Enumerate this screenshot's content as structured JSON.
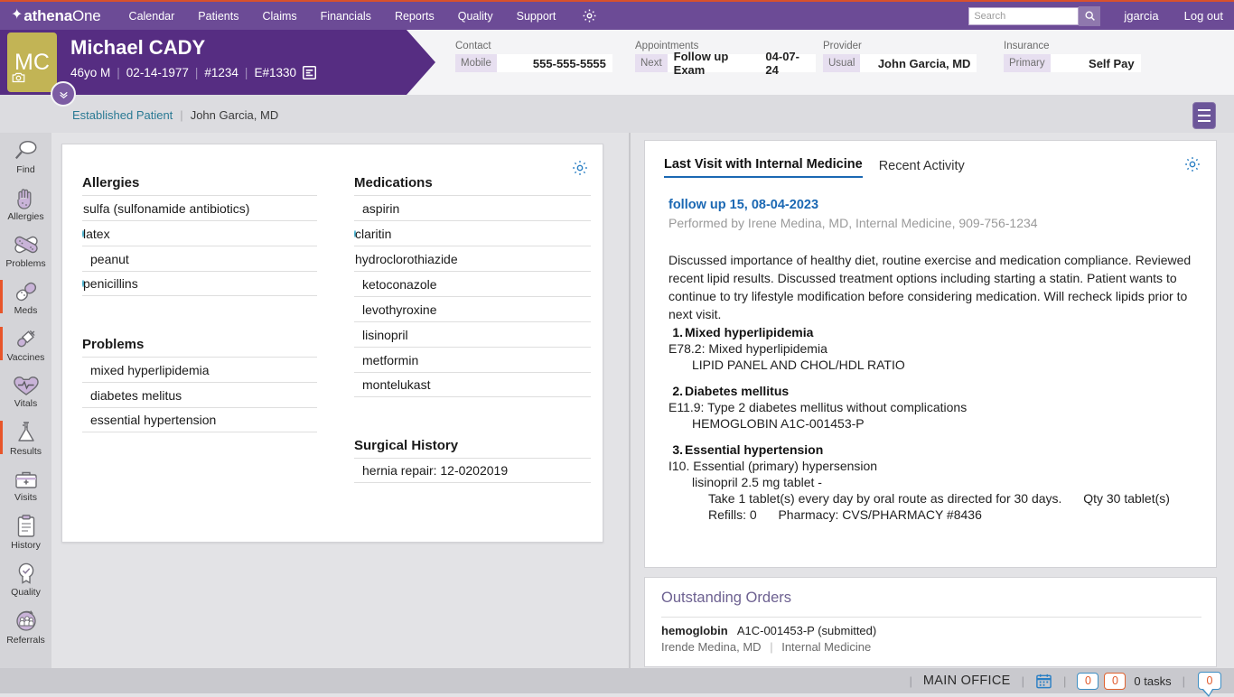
{
  "app": {
    "brand_prefix": "athena",
    "brand_suffix": "One",
    "nav_items": [
      {
        "label": "Calendar"
      },
      {
        "label": "Patients"
      },
      {
        "label": "Claims"
      },
      {
        "label": "Financials"
      },
      {
        "label": "Reports"
      },
      {
        "label": "Quality"
      },
      {
        "label": "Support"
      }
    ],
    "settings_icon": "gear-icon",
    "search": {
      "placeholder": "Search",
      "value": "",
      "button_icon": "search-icon"
    },
    "user": "jgarcia",
    "logout": "Log out",
    "accent_purple": "#562d82",
    "accent_orange": "#d9512c",
    "link_blue": "#1b68b3"
  },
  "patient": {
    "initials": "MC",
    "name": "Michael CADY",
    "age_sex": "46yo M",
    "dob": "02-14-1977",
    "patient_id": "#1234",
    "encounter_id": "E#1330",
    "encounter_icon": "encounter-note-icon",
    "camera_icon": "camera-icon"
  },
  "banner_fields": [
    {
      "id": "contact",
      "label": "Contact",
      "key": "Mobile",
      "value": "555-555-5555"
    },
    {
      "id": "appointments",
      "label": "Appointments",
      "key": "Next",
      "value_name": "Follow up Exam",
      "value_date": "04-07-24"
    },
    {
      "id": "provider",
      "label": "Provider",
      "key": "Usual",
      "value": "John Garcia, MD"
    },
    {
      "id": "insurance",
      "label": "Insurance",
      "key": "Primary",
      "value": "Self Pay"
    }
  ],
  "breadcrumb": {
    "expand_icon": "chevron-down-icon",
    "type": "Established Patient",
    "separator": "|",
    "provider": "John Garcia, MD",
    "right_toggle_icon": "menu-panel-icon"
  },
  "rail": [
    {
      "label": "Find",
      "icon": "magnifier-icon",
      "flagged": false
    },
    {
      "label": "Allergies",
      "icon": "hand-icon",
      "flagged": false
    },
    {
      "label": "Problems",
      "icon": "bandage-icon",
      "flagged": false
    },
    {
      "label": "Meds",
      "icon": "pill-icon",
      "flagged": true
    },
    {
      "label": "Vaccines",
      "icon": "syringe-icon",
      "flagged": true
    },
    {
      "label": "Vitals",
      "icon": "heart-pulse-icon",
      "flagged": false
    },
    {
      "label": "Results",
      "icon": "flask-icon",
      "flagged": true
    },
    {
      "label": "Visits",
      "icon": "medical-bag-icon",
      "flagged": false
    },
    {
      "label": "History",
      "icon": "clipboard-icon",
      "flagged": false
    },
    {
      "label": "Quality",
      "icon": "award-icon",
      "flagged": false
    },
    {
      "label": "Referrals",
      "icon": "people-cycle-icon",
      "flagged": false
    }
  ],
  "summary": {
    "gear_icon": "gear-icon",
    "allergies": {
      "title": "Allergies",
      "items": [
        {
          "name": "sulfa (sulfonamide antibiotics)",
          "marker": "filled"
        },
        {
          "name": "latex",
          "marker": "hollow"
        },
        {
          "name": "peanut",
          "marker": "none"
        },
        {
          "name": "penicillins",
          "marker": "hollow"
        }
      ]
    },
    "problems": {
      "title": "Problems",
      "items": [
        {
          "name": "mixed hyperlipidemia",
          "marker": "none"
        },
        {
          "name": "diabetes melitus",
          "marker": "none"
        },
        {
          "name": "essential hypertension",
          "marker": "none"
        }
      ]
    },
    "medications": {
      "title": "Medications",
      "items": [
        {
          "name": "aspirin",
          "marker": "none"
        },
        {
          "name": "claritin",
          "marker": "hollow"
        },
        {
          "name": "hydroclorothiazide",
          "marker": "filled"
        },
        {
          "name": "ketoconazole",
          "marker": "none"
        },
        {
          "name": "levothyroxine",
          "marker": "none"
        },
        {
          "name": "lisinopril",
          "marker": "none"
        },
        {
          "name": "metformin",
          "marker": "none"
        },
        {
          "name": "montelukast",
          "marker": "none"
        }
      ]
    },
    "surgical_history": {
      "title": "Surgical History",
      "items": [
        {
          "name": "hernia repair: 12-0202019",
          "marker": "none"
        }
      ]
    }
  },
  "visit": {
    "tabs": [
      {
        "label": "Last Visit with Internal Medicine",
        "active": true
      },
      {
        "label": "Recent Activity",
        "active": false
      }
    ],
    "gear_icon": "gear-icon",
    "title": "follow up 15, 08-04-2023",
    "performed_by": "Performed by Irene Medina, MD, Internal Medicine, 909-756-1234",
    "narrative": "Discussed importance of healthy diet, routine exercise and medication compliance. Reviewed recent lipid results.  Discussed treatment options including starting a statin. Patient wants to continue to try lifestyle modification before considering medication. Will recheck lipids prior to next visit.",
    "diagnoses": [
      {
        "num": "1.",
        "heading": "Mixed hyperlipidemia",
        "code": "E78.2: Mixed hyperlipidemia",
        "sub": [
          "LIPID PANEL AND CHOL/HDL RATIO"
        ],
        "sub2": []
      },
      {
        "num": "2.",
        "heading": "Diabetes mellitus",
        "code": "E11.9: Type 2 diabetes mellitus without complications",
        "sub": [
          "HEMOGLOBIN A1C-001453-P"
        ],
        "sub2": []
      },
      {
        "num": "3.",
        "heading": "Essential hypertension",
        "code": "I10. Essential (primary) hypersension",
        "sub": [
          "lisinopril 2.5 mg tablet -"
        ],
        "sub2": [
          {
            "a": "Take 1 tablet(s) every day by oral route as directed for 30 days.",
            "b": "Qty 30 tablet(s)"
          },
          {
            "a": "Refills: 0",
            "b": "Pharmacy: CVS/PHARMACY #8436"
          }
        ]
      }
    ]
  },
  "orders": {
    "title": "Outstanding Orders",
    "item_name": "hemoglobin",
    "item_detail": "A1C-001453-P (submitted)",
    "ordered_by": "Irende Medina, MD",
    "separator": "|",
    "department": "Internal Medicine"
  },
  "statusbar": {
    "office": "MAIN OFFICE",
    "calendar_icon": "calendar-icon",
    "badge_blue": "0",
    "badge_orange": "0",
    "tasks": "0 tasks",
    "messages_icon": "message-bubble-icon",
    "messages_count": "0"
  }
}
